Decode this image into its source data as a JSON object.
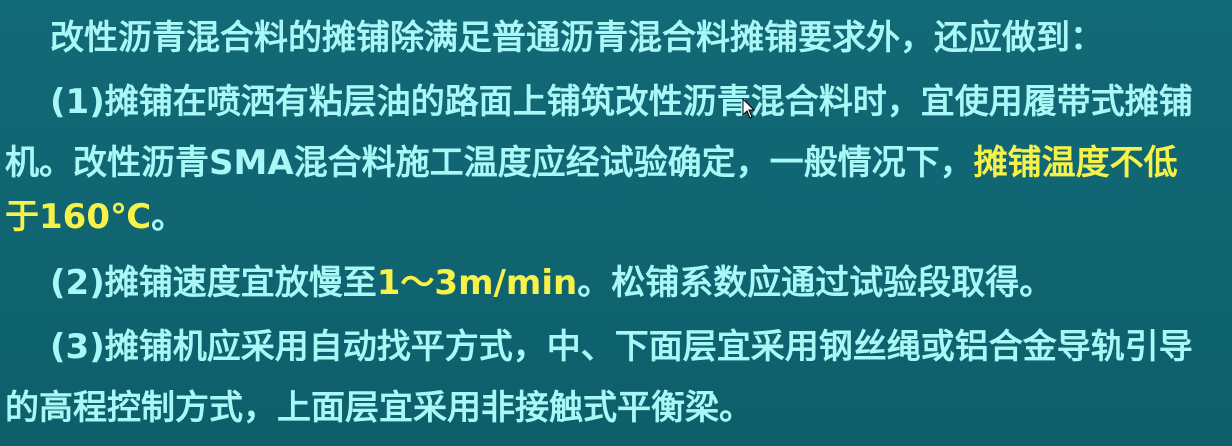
{
  "slide": {
    "intro": "改性沥青混合料的摊铺除满足普通沥青混合料摊铺要求外，还应做到：",
    "item1_line1": "(1)摊铺在喷洒有粘层油的路面上铺筑改性沥青混合料时，宜使用履带式摊铺",
    "item1_line2_a": "机。改性沥青SMA混合料施工温度应经试验确定，一般情况下，",
    "item1_line2_highlight": "摊铺温度不低",
    "item1_line3_highlight": "于160℃",
    "item1_line3_end": "。",
    "item2_a": "(2)摊铺速度宜放慢至",
    "item2_highlight": "1～3m/min",
    "item2_b": "。松铺系数应通过试验段取得。",
    "item3_line1": "(3)摊铺机应采用自动找平方式，中、下面层宜采用钢丝绳或铝合金导轨引导",
    "item3_line2": "的高程控制方式，上面层宜采用非接触式平衡梁。",
    "highlight_color": "#f6f24a",
    "text_color": "#a9f7f7",
    "background_color": "#0f6470",
    "cursor_icon": "mouse-pointer-icon"
  }
}
